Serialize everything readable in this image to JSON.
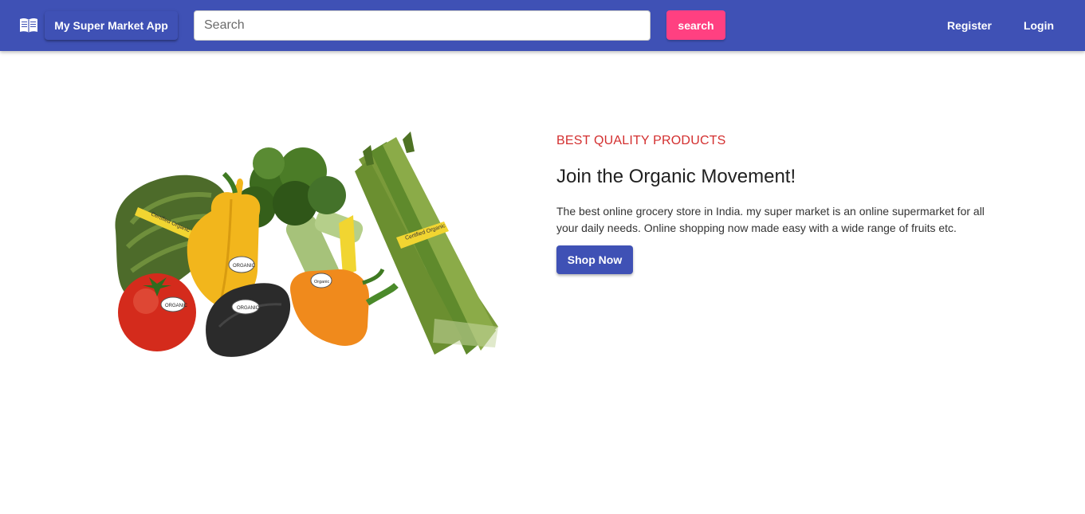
{
  "header": {
    "brand_label": "My Super Market App",
    "search": {
      "placeholder": "Search",
      "value": ""
    },
    "search_button_label": "search",
    "nav": {
      "register_label": "Register",
      "login_label": "Login"
    }
  },
  "hero": {
    "eyebrow": "BEST QUALITY PRODUCTS",
    "headline": "Join the Organic Movement!",
    "description": "The best online grocery store in India. my super market is an online supermarket for all your daily needs. Online shopping now made easy with a wide range of fruits etc.",
    "cta_label": "Shop Now",
    "image": {
      "labels": [
        "Certified Organic",
        "ORGANIC",
        "ORGANIC",
        "Organic",
        "ORGANIC",
        "Certified Organic"
      ]
    }
  },
  "icons": {
    "menu_book": "book-icon"
  },
  "colors": {
    "primary": "#3f51b5",
    "accent": "#ff4081",
    "eyebrow": "#d32f2f"
  }
}
